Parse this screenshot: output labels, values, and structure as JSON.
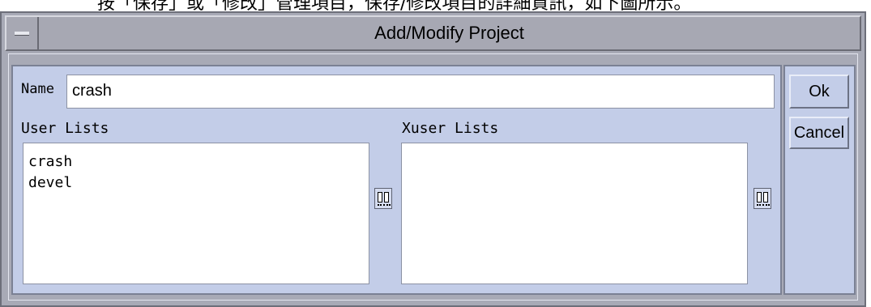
{
  "window": {
    "title": "Add/Modify Project",
    "menu_icon": "window-menu-icon",
    "top_caption": "按「保存」或「修改」管理項目，保存/修改項目的詳細資訊，如下圖所示。"
  },
  "form": {
    "name_label": "Name",
    "name_value": "crash",
    "user_lists": {
      "label": "User Lists",
      "items": [
        "crash",
        "devel"
      ]
    },
    "xuser_lists": {
      "label": "Xuser Lists",
      "items": []
    },
    "swap_icon": "list-chooser-icon"
  },
  "buttons": {
    "ok": "Ok",
    "cancel": "Cancel"
  }
}
